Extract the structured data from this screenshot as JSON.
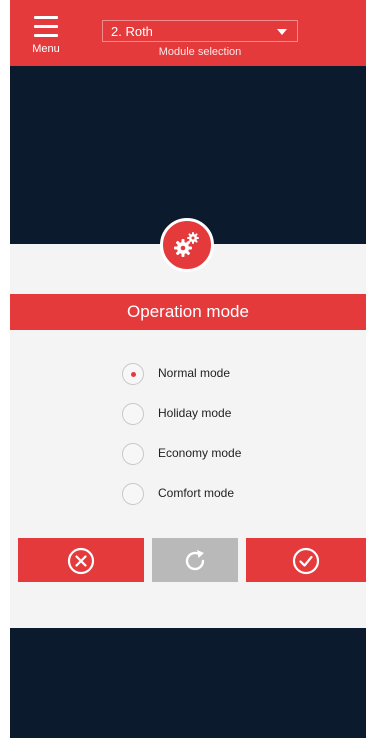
{
  "header": {
    "menu_label": "Menu",
    "module_value": "2. Roth",
    "module_caption": "Module selection"
  },
  "panel": {
    "title": "Operation mode",
    "options": [
      {
        "label": "Normal mode",
        "selected": true
      },
      {
        "label": "Holiday mode",
        "selected": false
      },
      {
        "label": "Economy mode",
        "selected": false
      },
      {
        "label": "Comfort mode",
        "selected": false
      }
    ]
  },
  "icons": {
    "menu": "hamburger-icon",
    "module": "chevron-down-icon",
    "badge": "gears-icon",
    "cancel": "close-circle-icon",
    "reset": "refresh-icon",
    "confirm": "check-circle-icon"
  },
  "colors": {
    "accent": "#e53a3c",
    "background": "#0c1a2e",
    "panel": "#f4f4f4",
    "disabled": "#b9b9b9"
  }
}
